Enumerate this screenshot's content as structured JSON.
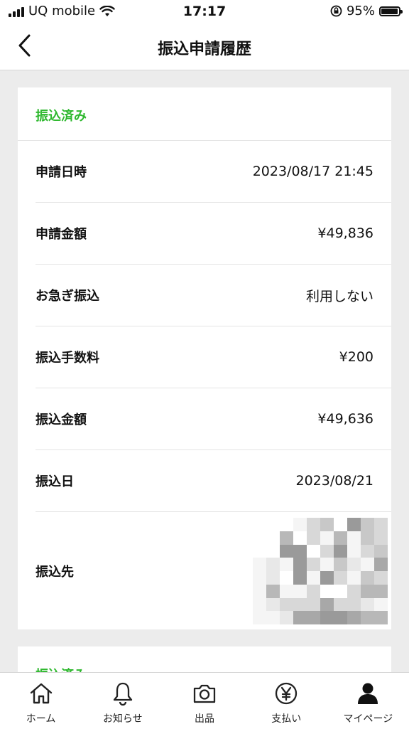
{
  "status_bar": {
    "carrier": "UQ mobile",
    "time": "17:17",
    "battery_percent": "95%",
    "battery_level": 0.95
  },
  "header": {
    "title": "振込申請履歴",
    "back_icon": "chevron-left-icon"
  },
  "records": [
    {
      "status": "振込済み",
      "status_color": "#2eb82e",
      "rows": [
        {
          "label": "申請日時",
          "value": "2023/08/17 21:45"
        },
        {
          "label": "申請金額",
          "value": "¥49,836"
        },
        {
          "label": "お急ぎ振込",
          "value": "利用しない"
        },
        {
          "label": "振込手数料",
          "value": "¥200"
        },
        {
          "label": "振込金額",
          "value": "¥49,636"
        },
        {
          "label": "振込日",
          "value": "2023/08/21"
        },
        {
          "label": "振込先",
          "value": ""
        }
      ]
    },
    {
      "status": "振込済み",
      "status_color": "#2eb82e"
    }
  ],
  "tab_bar": {
    "items": [
      {
        "label": "ホーム",
        "icon": "home-icon"
      },
      {
        "label": "お知らせ",
        "icon": "bell-icon"
      },
      {
        "label": "出品",
        "icon": "camera-icon"
      },
      {
        "label": "支払い",
        "icon": "yen-circle-icon"
      },
      {
        "label": "マイページ",
        "icon": "person-icon"
      }
    ]
  }
}
